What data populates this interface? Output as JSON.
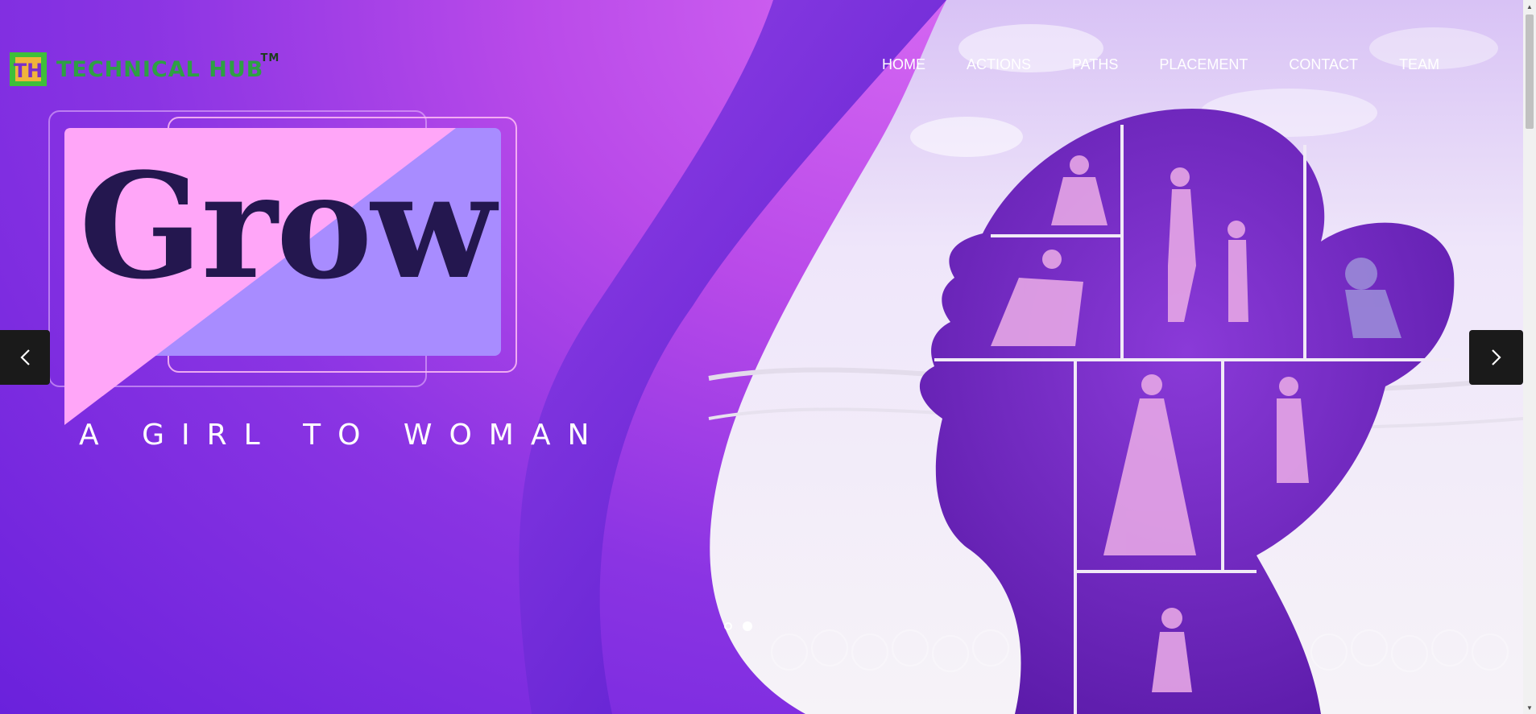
{
  "brand": {
    "name": "TECHNICAL HUB",
    "trademark": "TM",
    "mark_letters": "TH",
    "colors": {
      "text": "#2ea043",
      "mark_outer": "#3fbf3a",
      "mark_inner": "#f0b43a"
    }
  },
  "nav": {
    "items": [
      {
        "label": "HOME"
      },
      {
        "label": "ACTIONS"
      },
      {
        "label": "PATHS"
      },
      {
        "label": "PLACEMENT"
      },
      {
        "label": "CONTACT"
      },
      {
        "label": "TEAM"
      }
    ]
  },
  "slide": {
    "headline": "Grow",
    "tagline": "A GIRL TO WOMAN",
    "colors": {
      "pink": "#ffa6f8",
      "lavender": "#a88cff",
      "ink": "#24174f",
      "accent_purple": "#7b2ae0"
    }
  },
  "carousel": {
    "prev_icon": "chevron-left-icon",
    "next_icon": "chevron-right-icon",
    "slide_count": 2,
    "active_index": 1
  },
  "scrollbar": {
    "up_icon": "triangle-up-icon",
    "down_icon": "triangle-down-icon"
  }
}
